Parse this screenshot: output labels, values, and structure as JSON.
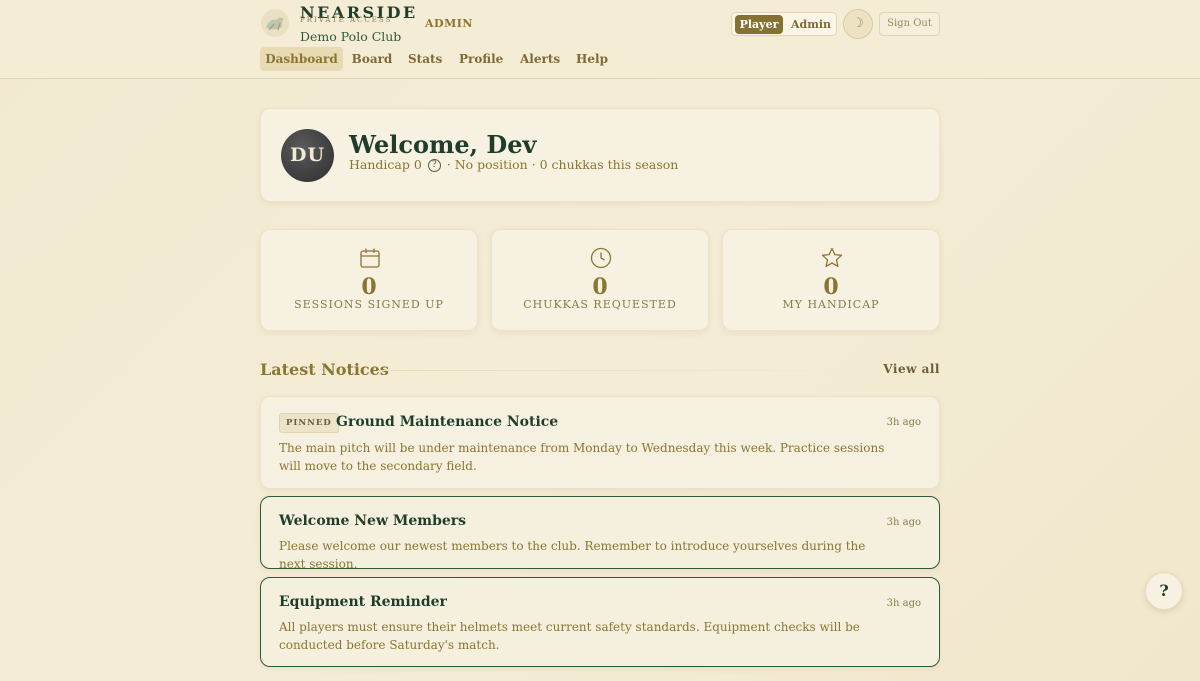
{
  "header": {
    "brand_title": "NEARSIDE",
    "brand_sub": "PRIVATE ACCESS",
    "club_name": "Demo Polo Club",
    "admin_badge": "ADMIN",
    "role_player": "Player",
    "role_admin": "Admin",
    "theme_icon": "☽",
    "signout_label": "Sign Out"
  },
  "nav": {
    "items": [
      {
        "label": "Dashboard",
        "active": true
      },
      {
        "label": "Board"
      },
      {
        "label": "Stats"
      },
      {
        "label": "Profile"
      },
      {
        "label": "Alerts"
      },
      {
        "label": "Help"
      }
    ]
  },
  "welcome": {
    "initials": "DU",
    "title": "Welcome, Dev",
    "handicap_text": "Handicap 0",
    "help_glyph": "?",
    "rest_text": "· No position · 0 chukkas this season"
  },
  "stats": [
    {
      "icon": "calendar-icon",
      "value": "0",
      "label": "SESSIONS SIGNED UP"
    },
    {
      "icon": "clock-icon",
      "value": "0",
      "label": "CHUKKAS REQUESTED"
    },
    {
      "icon": "star-icon",
      "value": "0",
      "label": "MY HANDICAP"
    }
  ],
  "notices_section": {
    "title": "Latest Notices",
    "view_all": "View all"
  },
  "notices": [
    {
      "pinned_label": "PINNED",
      "title": "Ground Maintenance Notice",
      "time": "3h ago",
      "body": "The main pitch will be under maintenance from Monday to Wednesday this week. Practice sessions will move to the secondary field."
    },
    {
      "title": "Welcome New Members",
      "time": "3h ago",
      "body": "Please welcome our newest members to the club. Remember to introduce yourselves during the next session."
    },
    {
      "title": "Equipment Reminder",
      "time": "3h ago",
      "body": "All players must ensure their helmets meet current safety standards. Equipment checks will be conducted before Saturday's match."
    }
  ],
  "help_fab": "?",
  "colors": {
    "accent_gold": "#857232",
    "primary_green": "#1f3d2a",
    "background": "#f3ead2"
  }
}
